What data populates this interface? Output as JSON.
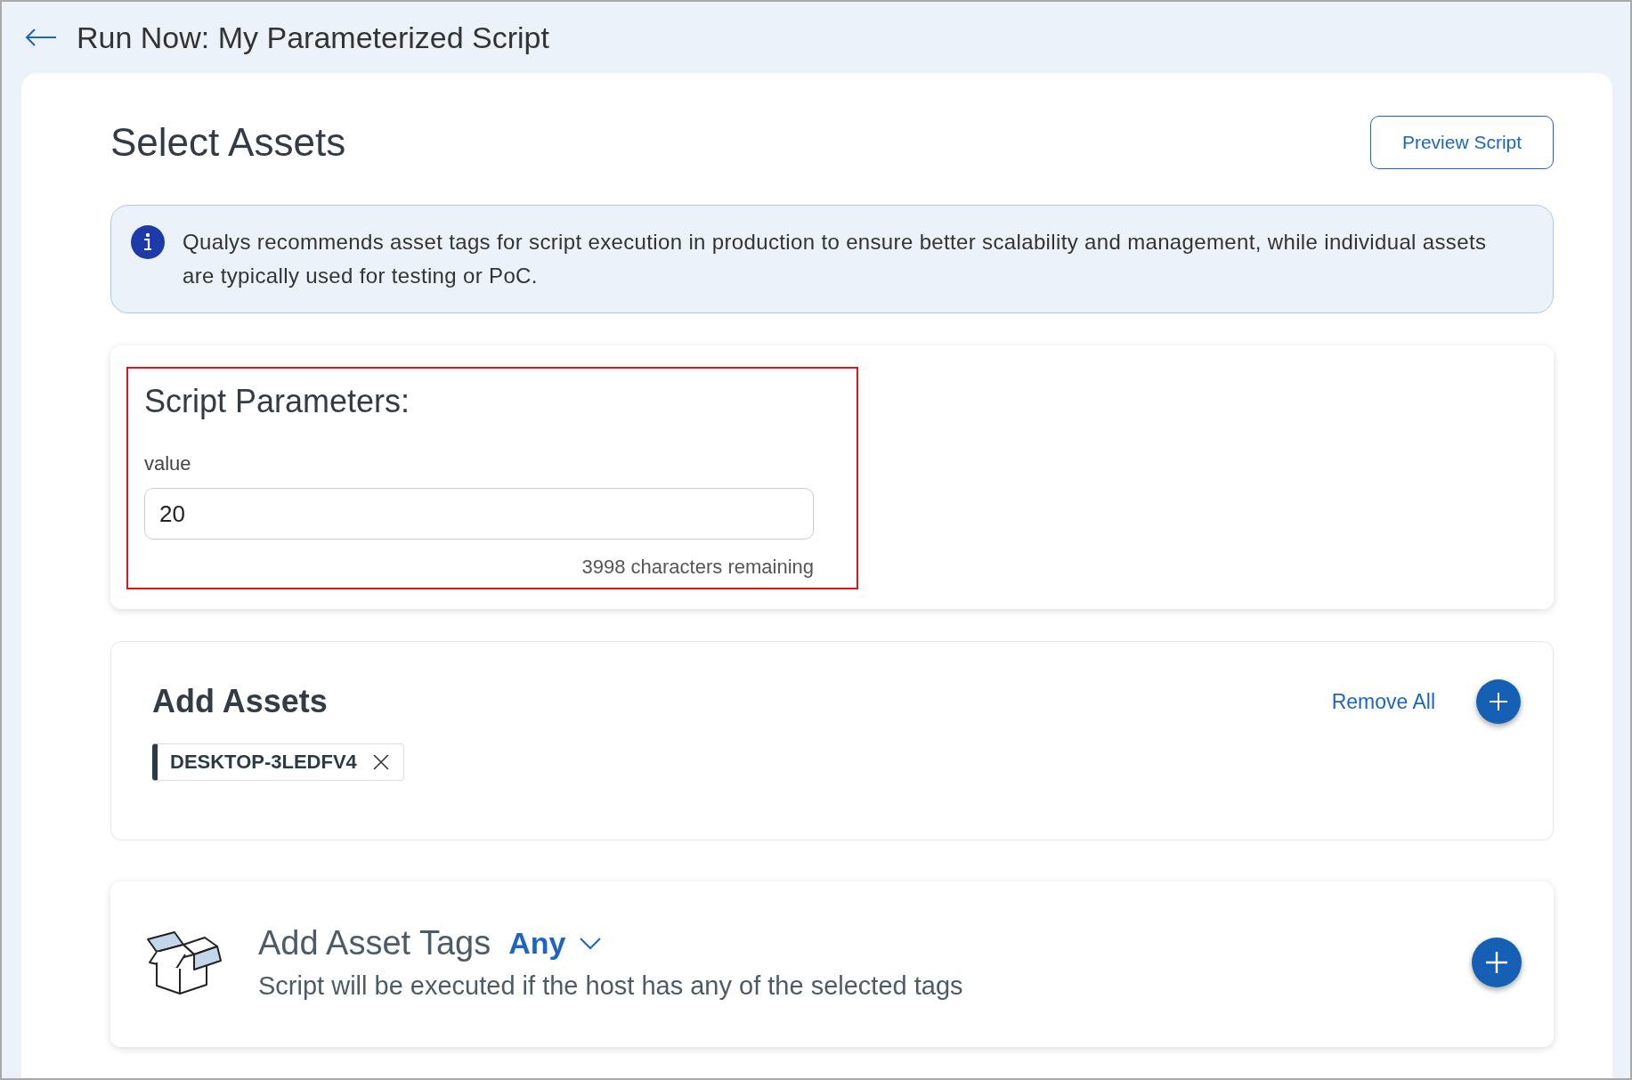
{
  "header": {
    "title": "Run Now: My Parameterized Script"
  },
  "page": {
    "title": "Select Assets",
    "preview_button": "Preview Script"
  },
  "info_banner": {
    "text": "Qualys recommends asset tags for script execution in production to ensure better scalability and management, while individual assets are typically used for testing or PoC."
  },
  "script_parameters": {
    "title": "Script Parameters:",
    "highlighted": true,
    "fields": [
      {
        "label": "value",
        "value": "20",
        "helper": "3998 characters remaining"
      }
    ]
  },
  "add_assets": {
    "title": "Add Assets",
    "remove_all": "Remove All",
    "assets": [
      {
        "name": "DESKTOP-3LEDFV4"
      }
    ]
  },
  "add_asset_tags": {
    "title": "Add Asset Tags",
    "match": "Any",
    "description": "Script will be executed if the host has any of the selected tags"
  }
}
